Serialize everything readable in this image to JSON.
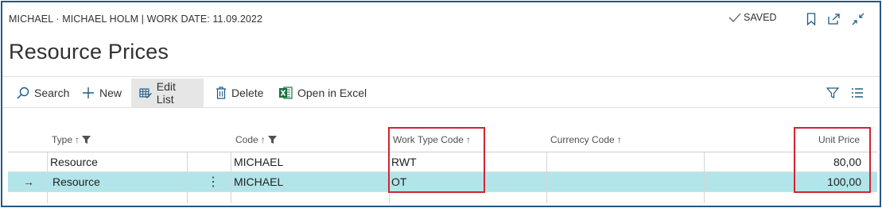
{
  "context": "MICHAEL · MICHAEL HOLM | WORK DATE: 11.09.2022",
  "saved_label": "SAVED",
  "page_title": "Resource Prices",
  "actions": {
    "search": "Search",
    "new": "New",
    "edit_list": "Edit List",
    "delete": "Delete",
    "open_excel": "Open in Excel"
  },
  "columns": {
    "type": "Type",
    "code": "Code",
    "work_type_code": "Work Type Code",
    "currency_code": "Currency Code",
    "unit_price": "Unit Price"
  },
  "rows": [
    {
      "type": "Resource",
      "code": "MICHAEL",
      "work_type_code": "RWT",
      "currency_code": "",
      "unit_price": "80,00"
    },
    {
      "type": "Resource",
      "code": "MICHAEL",
      "work_type_code": "OT",
      "currency_code": "",
      "unit_price": "100,00"
    }
  ],
  "colors": {
    "accent": "#1f5b86",
    "selected_row": "#b2e5ea",
    "highlight_box": "#d1242f",
    "excel_green": "#1d6f42"
  }
}
